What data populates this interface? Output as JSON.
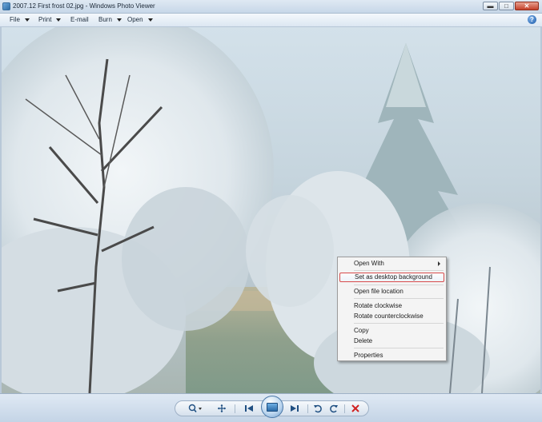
{
  "window": {
    "title": "2007.12 First frost 02.jpg - Windows Photo Viewer",
    "minimize_label": "▬",
    "maximize_label": "□",
    "close_label": "✕"
  },
  "toolbar": {
    "file": "File",
    "print": "Print",
    "email": "E-mail",
    "burn": "Burn",
    "open": "Open",
    "help": "?"
  },
  "context_menu": {
    "open_with": "Open With",
    "set_desktop_background": "Set as desktop background",
    "open_file_location": "Open file location",
    "rotate_clockwise": "Rotate clockwise",
    "rotate_counterclockwise": "Rotate counterclockwise",
    "copy": "Copy",
    "delete": "Delete",
    "properties": "Properties"
  },
  "colors": {
    "highlight_border": "#d84a4a",
    "accent": "#2b6aa7",
    "delete_red": "#d02020"
  },
  "icons": {
    "zoom": "magnifier-icon",
    "actual_size": "fit-icon",
    "previous": "previous-icon",
    "slideshow": "slideshow-icon",
    "next": "next-icon",
    "rotate_ccw": "rotate-counterclockwise-icon",
    "rotate_cw": "rotate-clockwise-icon",
    "delete": "delete-icon"
  }
}
